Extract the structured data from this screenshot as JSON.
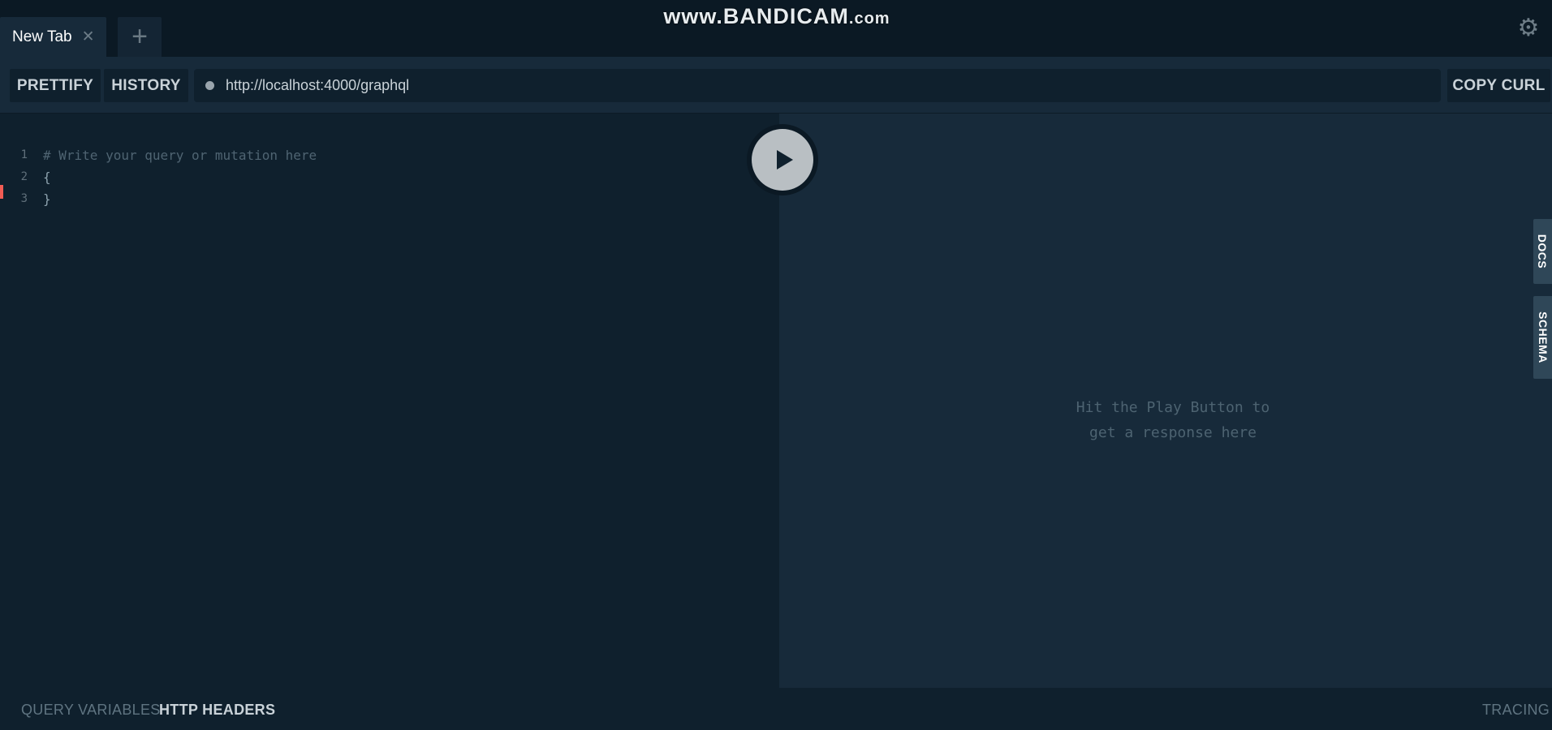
{
  "tabs": {
    "items": [
      {
        "title": "New Tab",
        "close_glyph": "✕"
      }
    ],
    "add_glyph": "+"
  },
  "watermark": {
    "main": "www.BANDICAM",
    "suffix": ".com"
  },
  "settings": {
    "icon": "gear-icon",
    "glyph": "⚙"
  },
  "toolbar": {
    "prettify_label": "PRETTIFY",
    "history_label": "HISTORY",
    "endpoint_url": "http://localhost:4000/graphql",
    "copy_curl_label": "COPY CURL"
  },
  "editor": {
    "lines": [
      {
        "number": "1",
        "text": "# Write your query or mutation here"
      },
      {
        "number": "2",
        "text": "{"
      },
      {
        "number": "3",
        "text": "}"
      }
    ]
  },
  "result": {
    "placeholder_line1": "Hit the Play Button to",
    "placeholder_line2": "get a response here"
  },
  "side_tabs": {
    "docs_label": "DOCS",
    "schema_label": "SCHEMA"
  },
  "bottom": {
    "query_variables_label": "QUERY VARIABLES",
    "http_headers_label": "HTTP HEADERS",
    "tracing_label": "TRACING"
  },
  "colors": {
    "background_dark": "#0f202d",
    "background_panel": "#172a3a",
    "accent_error": "#f25c54"
  }
}
